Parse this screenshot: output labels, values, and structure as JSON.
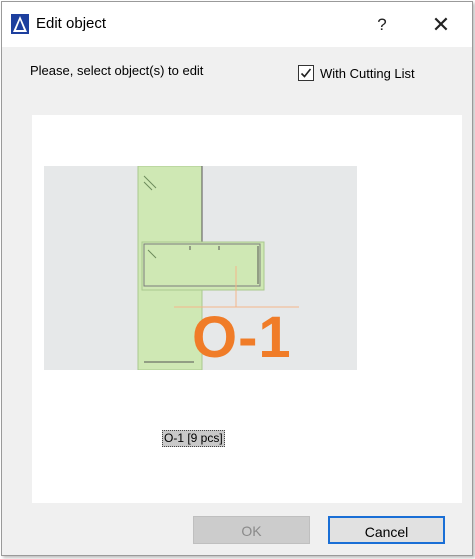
{
  "dialog": {
    "title": "Edit object",
    "help_label": "?",
    "close_label": "✕"
  },
  "prompt": "Please, select object(s) to edit",
  "cutting_list": {
    "label": "With Cutting List",
    "checked": true
  },
  "preview": {
    "mark": "O-1",
    "item_label": "O-1 [9 pcs]"
  },
  "buttons": {
    "ok": "OK",
    "cancel": "Cancel"
  },
  "colors": {
    "accent": "#1a6fd6",
    "mark": "#f07c28",
    "part_fill": "#cfe8b4"
  }
}
